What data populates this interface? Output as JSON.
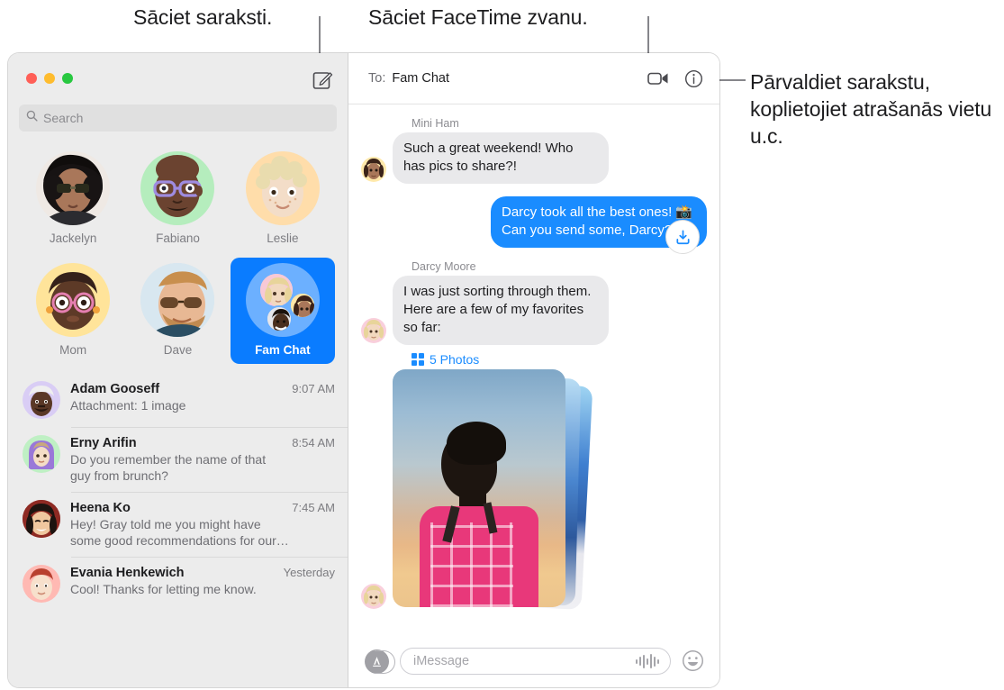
{
  "callouts": [
    {
      "id": "compose",
      "text": "Sāciet saraksti."
    },
    {
      "id": "facetime",
      "text": "Sāciet FaceTime zvanu."
    },
    {
      "id": "details",
      "text": "Pārvaldiet sarakstu, koplietojiet atrašanās vietu u.c."
    }
  ],
  "window": {
    "traffic_lights": {
      "close": "close-button",
      "minimize": "minimize-button",
      "zoom": "zoom-button"
    },
    "compose_icon": "compose-icon"
  },
  "sidebar": {
    "search": {
      "placeholder": "Search",
      "icon": "search-icon"
    },
    "pinned": [
      {
        "name": "Jackelyn",
        "selected": false
      },
      {
        "name": "Fabiano",
        "selected": false
      },
      {
        "name": "Leslie",
        "selected": false
      },
      {
        "name": "Mom",
        "selected": false
      },
      {
        "name": "Dave",
        "selected": false
      },
      {
        "name": "Fam Chat",
        "selected": true
      }
    ],
    "conversations": [
      {
        "name": "Adam Gooseff",
        "time": "9:07 AM",
        "snippet": "Attachment: 1 image"
      },
      {
        "name": "Erny Arifin",
        "time": "8:54 AM",
        "snippet": "Do you remember the name of that\nguy from brunch?"
      },
      {
        "name": "Heena Ko",
        "time": "7:45 AM",
        "snippet": "Hey! Gray told me you might have\nsome good recommendations for our…"
      },
      {
        "name": "Evania Henkewich",
        "time": "Yesterday",
        "snippet": "Cool! Thanks for letting me know."
      }
    ]
  },
  "chat": {
    "header": {
      "to_label": "To:",
      "recipient": "Fam Chat",
      "facetime_icon": "video-camera-icon",
      "details_icon": "info-icon"
    },
    "messages": [
      {
        "sender": "Mini Ham",
        "direction": "in",
        "text": "Such a great weekend! Who has pics to share?!"
      },
      {
        "sender": "",
        "direction": "out",
        "text": "Darcy took all the best ones! 📸 Can you send some, Darcy?"
      },
      {
        "sender": "Darcy Moore",
        "direction": "in",
        "text": "I was just sorting through them. Here are a few of my favorites so far:"
      }
    ],
    "attachment": {
      "label": "5 Photos",
      "grid_icon": "grid-icon",
      "download_icon": "download-icon"
    },
    "input": {
      "apps_icon": "app-store-icon",
      "placeholder": "iMessage",
      "audio_icon": "audio-waveform-icon",
      "emoji_icon": "smiley-face-icon"
    }
  },
  "colors": {
    "accent_blue": "#0a7cff",
    "bubble_out": "#1a8cff",
    "bubble_in": "#e9e9eb",
    "sidebar_bg": "#ececec"
  }
}
